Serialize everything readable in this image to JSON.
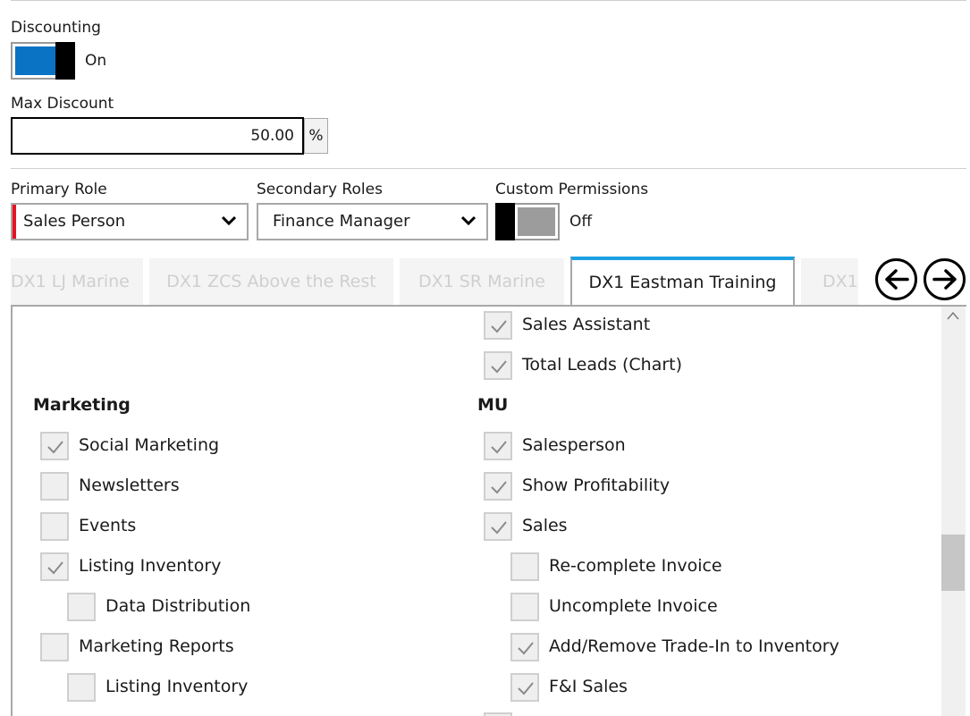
{
  "discounting": {
    "label": "Discounting",
    "state_label": "On",
    "enabled": true,
    "accent_color": "#0a73c4"
  },
  "max_discount": {
    "label": "Max Discount",
    "value": "50.00",
    "unit": "%"
  },
  "roles": {
    "primary_label": "Primary Role",
    "primary_value": "Sales Person",
    "secondary_label": "Secondary Roles",
    "secondary_value": "Finance Manager",
    "required_marker_color": "#e81123"
  },
  "custom_permissions": {
    "label": "Custom Permissions",
    "state_label": "Off",
    "enabled": false
  },
  "tabs": [
    {
      "label": "DX1 LJ Marine",
      "active": false
    },
    {
      "label": "DX1 ZCS Above the Rest",
      "active": false
    },
    {
      "label": "DX1 SR Marine",
      "active": false
    },
    {
      "label": "DX1 Eastman Training",
      "active": true
    },
    {
      "label": "DX1",
      "active": false
    }
  ],
  "tab_accent_color": "#1ba1e2",
  "nav_icons": {
    "prev": "arrow-left-circle-icon",
    "next": "arrow-right-circle-icon"
  },
  "permissions": {
    "right_top": [
      {
        "label": "Sales Assistant",
        "checked": true
      },
      {
        "label": "Total Leads (Chart)",
        "checked": true
      }
    ],
    "marketing": {
      "title": "Marketing",
      "items": [
        {
          "label": "Social Marketing",
          "checked": true
        },
        {
          "label": "Newsletters",
          "checked": false
        },
        {
          "label": "Events",
          "checked": false
        },
        {
          "label": "Listing Inventory",
          "checked": true
        },
        {
          "label": "Data Distribution",
          "checked": false
        },
        {
          "label": "Marketing Reports",
          "checked": false
        },
        {
          "label": "Listing Inventory",
          "checked": false
        }
      ]
    },
    "mu": {
      "title": "MU",
      "items": [
        {
          "label": "Salesperson",
          "checked": true
        },
        {
          "label": "Show Profitability",
          "checked": true
        },
        {
          "label": "Sales",
          "checked": true
        },
        {
          "label": "Re-complete Invoice",
          "checked": false
        },
        {
          "label": "Uncomplete Invoice",
          "checked": false
        },
        {
          "label": "Add/Remove Trade-In to Inventory",
          "checked": true
        },
        {
          "label": "F&I Sales",
          "checked": true
        }
      ]
    }
  }
}
